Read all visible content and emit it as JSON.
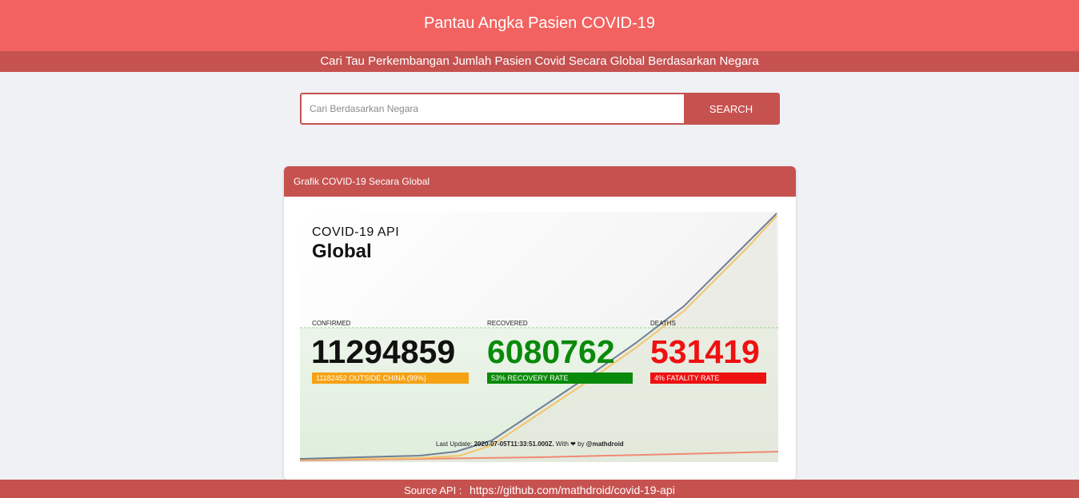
{
  "header": {
    "title": "Pantau Angka Pasien COVID-19",
    "subtitle": "Cari Tau Perkembangan Jumlah Pasien Covid Secara Global Berdasarkan Negara"
  },
  "search": {
    "placeholder": "Cari Berdasarkan Negara",
    "value": "",
    "button_label": "SEARCH"
  },
  "card": {
    "title": "Grafik COVID-19 Secara Global"
  },
  "chart_image": {
    "api_label": "COVID-19 API",
    "region": "Global",
    "confirmed_label": "CONFIRMED",
    "confirmed_value": "11294859",
    "confirmed_sub": "11182452 OUTSIDE CHINA (99%)",
    "recovered_label": "RECOVERED",
    "recovered_value": "6080762",
    "recovered_sub": "53% RECOVERY RATE",
    "deaths_label": "DEATHS",
    "deaths_value": "531419",
    "deaths_sub": "4% FATALITY RATE",
    "last_update_prefix": "Last Update:",
    "last_update_value": "2020-07-05T11:33:51.000Z.",
    "with_text": "With",
    "by_text": "by",
    "author": "@mathdroid",
    "colors": {
      "confirmed": "#111111",
      "recovered": "#0a8a0a",
      "deaths": "#ee1111",
      "confirmed_bar": "#f5a214",
      "recovered_bar": "#0a8a0a",
      "deaths_bar": "#ee1111"
    }
  },
  "footer": {
    "label": "Source API :",
    "url": "https://github.com/mathdroid/covid-19-api"
  }
}
